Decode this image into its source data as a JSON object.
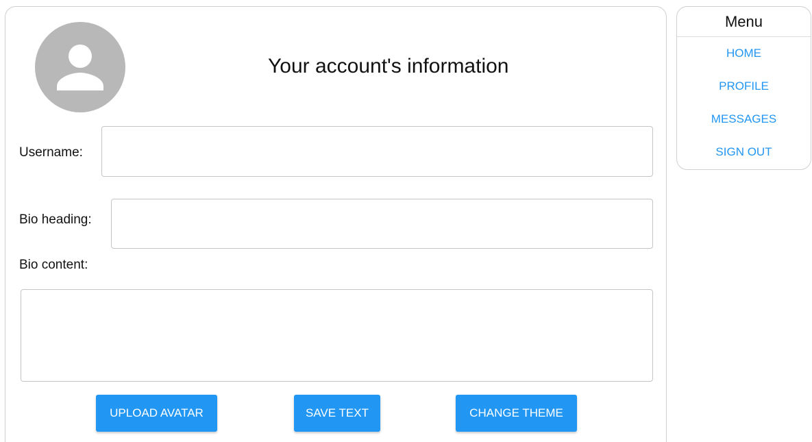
{
  "profile": {
    "title": "Your account's information",
    "avatar_icon": "person-icon",
    "username_label": "Username:",
    "username_value": "",
    "bio_heading_label": "Bio heading:",
    "bio_heading_value": "",
    "bio_content_label": "Bio content:",
    "bio_content_value": ""
  },
  "actions": {
    "upload_avatar": "UPLOAD AVATAR",
    "save_text": "SAVE TEXT",
    "change_theme": "CHANGE THEME"
  },
  "menu": {
    "title": "Menu",
    "items": [
      {
        "label": "HOME"
      },
      {
        "label": "PROFILE"
      },
      {
        "label": "MESSAGES"
      },
      {
        "label": "SIGN OUT"
      }
    ]
  },
  "colors": {
    "accent": "#2196f3",
    "avatar_bg": "#b8b8b8",
    "border": "#cfcfcf"
  }
}
